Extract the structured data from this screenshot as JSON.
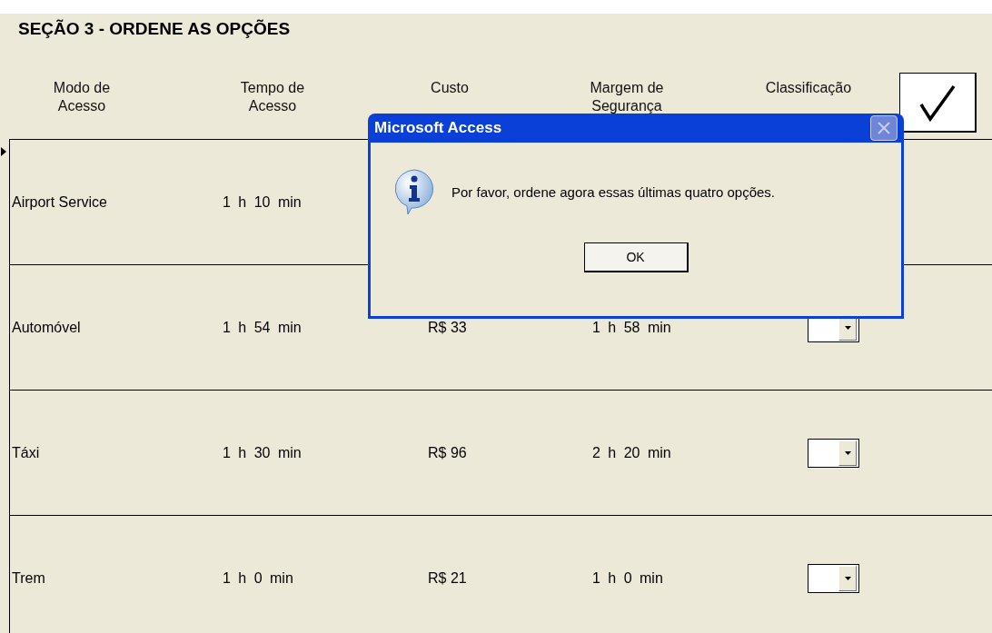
{
  "section_title": "SEÇÃO 3 - ORDENE AS OPÇÕES",
  "columns": [
    "Modo de\nAcesso",
    "Tempo de\nAcesso",
    "Custo",
    "Margem de\nSegurança",
    "Classificação"
  ],
  "rows": [
    {
      "mode": "Airport Service",
      "time": "1 h 10 min",
      "current": true,
      "combo": false
    },
    {
      "mode": "Automóvel",
      "time": "1 h 54 min",
      "cost": "R$ 33",
      "margin": "1 h 58 min",
      "current": false,
      "combo": true
    },
    {
      "mode": "Táxi",
      "time": "1 h 30 min",
      "cost": "R$ 96",
      "margin": "2 h 20 min",
      "current": false,
      "combo": true
    },
    {
      "mode": "Trem",
      "time": "1 h 0 min",
      "cost": "R$ 21",
      "margin": "1 h 0 min",
      "current": false,
      "combo": true
    }
  ],
  "dialog": {
    "title": "Microsoft Access",
    "message": "Por favor, ordene agora essas últimas quatro opções.",
    "button": "OK"
  }
}
